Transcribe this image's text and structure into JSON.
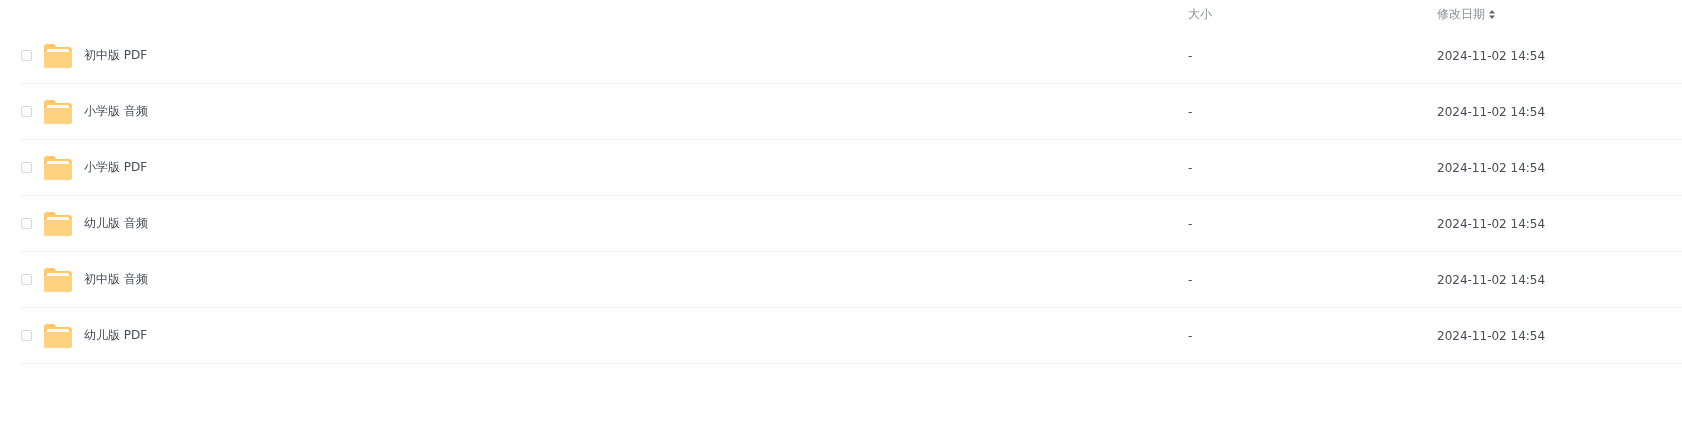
{
  "table": {
    "columns": [
      {
        "kind": "size",
        "label": "大小"
      },
      {
        "kind": "date",
        "label": "修改日期"
      }
    ],
    "rows": [
      {
        "name": "初中版 PDF",
        "size": "-",
        "modified": "2024-11-02 14:54",
        "checked": false
      },
      {
        "name": "小学版 音频",
        "size": "-",
        "modified": "2024-11-02 14:54",
        "checked": false
      },
      {
        "name": "小学版 PDF",
        "size": "-",
        "modified": "2024-11-02 14:54",
        "checked": false
      },
      {
        "name": "幼儿版 音频",
        "size": "-",
        "modified": "2024-11-02 14:54",
        "checked": false
      },
      {
        "name": "初中版 音频",
        "size": "-",
        "modified": "2024-11-02 14:54",
        "checked": false
      },
      {
        "name": "幼儿版 PDF",
        "size": "-",
        "modified": "2024-11-02 14:54",
        "checked": false
      }
    ]
  }
}
